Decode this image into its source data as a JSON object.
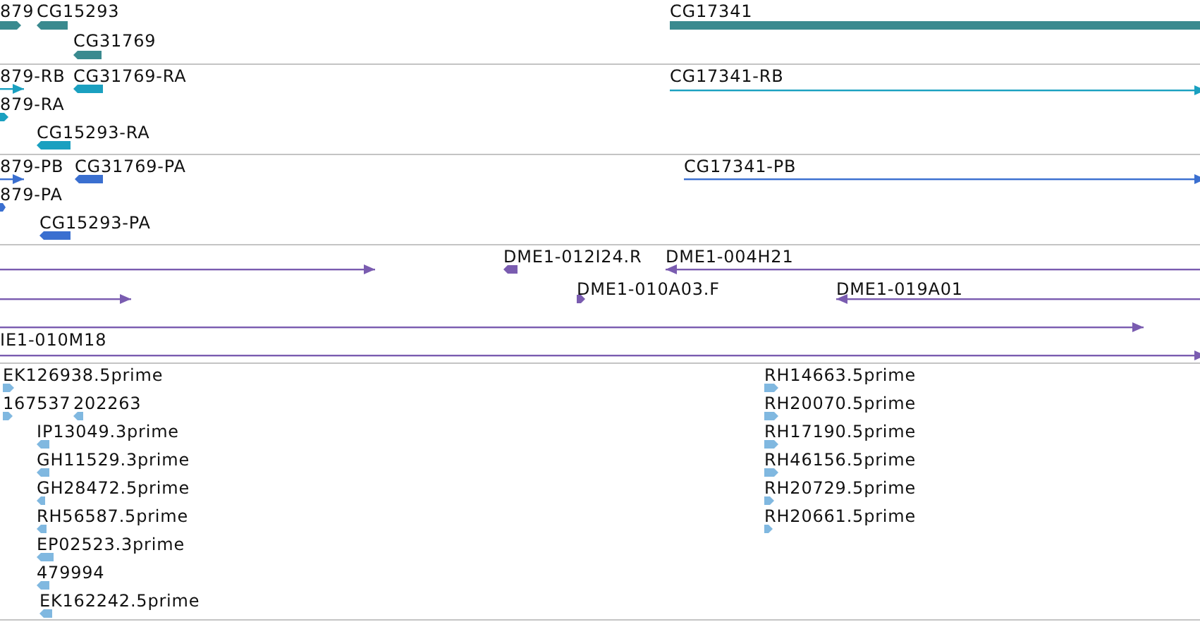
{
  "tracks": [
    {
      "color": "#3a8a8f",
      "features": [
        {
          "label": "879",
          "kind": "block",
          "reverse": false
        },
        {
          "label": "CG15293",
          "kind": "block",
          "reverse": true
        },
        {
          "label": "CG31769",
          "kind": "block",
          "reverse": true
        },
        {
          "label": "CG17341",
          "kind": "block",
          "reverse": false
        }
      ]
    },
    {
      "color": "#1aa0c0",
      "features": [
        {
          "label": "879-RB",
          "kind": "line",
          "reverse": false
        },
        {
          "label": "CG31769-RA",
          "kind": "block",
          "reverse": true
        },
        {
          "label": "CG17341-RB",
          "kind": "line",
          "reverse": false
        },
        {
          "label": "879-RA",
          "kind": "block",
          "reverse": false
        },
        {
          "label": "CG15293-RA",
          "kind": "block",
          "reverse": true
        }
      ]
    },
    {
      "color": "#3a6fd0",
      "features": [
        {
          "label": "879-PB",
          "kind": "line",
          "reverse": false
        },
        {
          "label": "CG31769-PA",
          "kind": "block",
          "reverse": true
        },
        {
          "label": "CG17341-PB",
          "kind": "line",
          "reverse": false
        },
        {
          "label": "879-PA",
          "kind": "block",
          "reverse": false
        },
        {
          "label": "CG15293-PA",
          "kind": "block",
          "reverse": true
        }
      ]
    },
    {
      "color": "#7a5cb0",
      "features": [
        {
          "kind": "line",
          "reverse": false
        },
        {
          "label": "DME1-012I24.R",
          "kind": "block",
          "reverse": true
        },
        {
          "label": "DME1-004H21",
          "kind": "line",
          "reverse": true
        },
        {
          "kind": "line",
          "reverse": false
        },
        {
          "label": "DME1-010A03.F",
          "kind": "block",
          "reverse": false
        },
        {
          "label": "DME1-019A01",
          "kind": "line",
          "reverse": true
        },
        {
          "kind": "line",
          "reverse": false
        },
        {
          "label": "IE1-010M18",
          "kind": "line",
          "reverse": false
        }
      ]
    },
    {
      "color": "#80b8e0",
      "features": [
        {
          "label": "EK126938.5prime",
          "kind": "block",
          "reverse": false
        },
        {
          "label": "167537",
          "kind": "block",
          "reverse": false
        },
        {
          "label": "202263",
          "kind": "block",
          "reverse": true
        },
        {
          "label": "IP13049.3prime",
          "kind": "block",
          "reverse": true
        },
        {
          "label": "GH11529.3prime",
          "kind": "block",
          "reverse": true
        },
        {
          "label": "GH28472.5prime",
          "kind": "block",
          "reverse": true
        },
        {
          "label": "RH56587.5prime",
          "kind": "block",
          "reverse": true
        },
        {
          "label": "EP02523.3prime",
          "kind": "block",
          "reverse": true
        },
        {
          "label": "479994",
          "kind": "block",
          "reverse": true
        },
        {
          "label": "EK162242.5prime",
          "kind": "block",
          "reverse": true
        },
        {
          "label": "RH14663.5prime",
          "kind": "block",
          "reverse": false
        },
        {
          "label": "RH20070.5prime",
          "kind": "block",
          "reverse": false
        },
        {
          "label": "RH17190.5prime",
          "kind": "block",
          "reverse": false
        },
        {
          "label": "RH46156.5prime",
          "kind": "block",
          "reverse": false
        },
        {
          "label": "RH20729.5prime",
          "kind": "block",
          "reverse": false
        },
        {
          "label": "RH20661.5prime",
          "kind": "block",
          "reverse": false
        }
      ]
    }
  ]
}
